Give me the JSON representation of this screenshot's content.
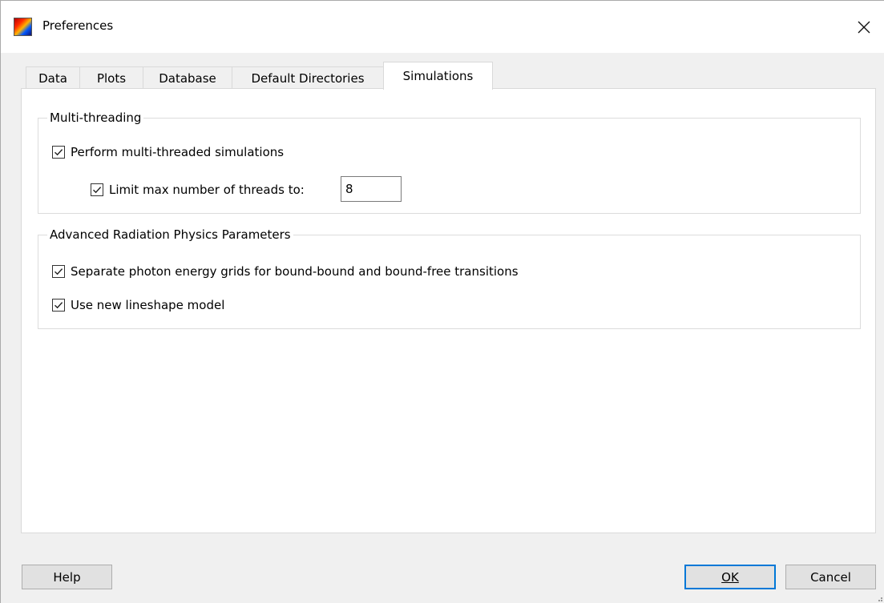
{
  "window": {
    "title": "Preferences"
  },
  "tabs": [
    {
      "label": "Data"
    },
    {
      "label": "Plots"
    },
    {
      "label": "Database"
    },
    {
      "label": "Default Directories"
    },
    {
      "label": "Simulations",
      "active": true
    }
  ],
  "multithreading": {
    "title": "Multi-threading",
    "perform_label": "Perform multi-threaded simulations",
    "perform_checked": true,
    "limit_label": "Limit max number of threads to:",
    "limit_checked": true,
    "threads_value": "8"
  },
  "radiation": {
    "title": "Advanced Radiation Physics Parameters",
    "separate_label": "Separate photon energy grids for bound-bound and bound-free transitions",
    "separate_checked": true,
    "lineshape_label": "Use new lineshape model",
    "lineshape_checked": true
  },
  "buttons": {
    "help": "Help",
    "ok": "OK",
    "cancel": "Cancel"
  },
  "colors": {
    "accent": "#0078d7",
    "panel": "#ffffff",
    "dialog": "#f0f0f0"
  }
}
